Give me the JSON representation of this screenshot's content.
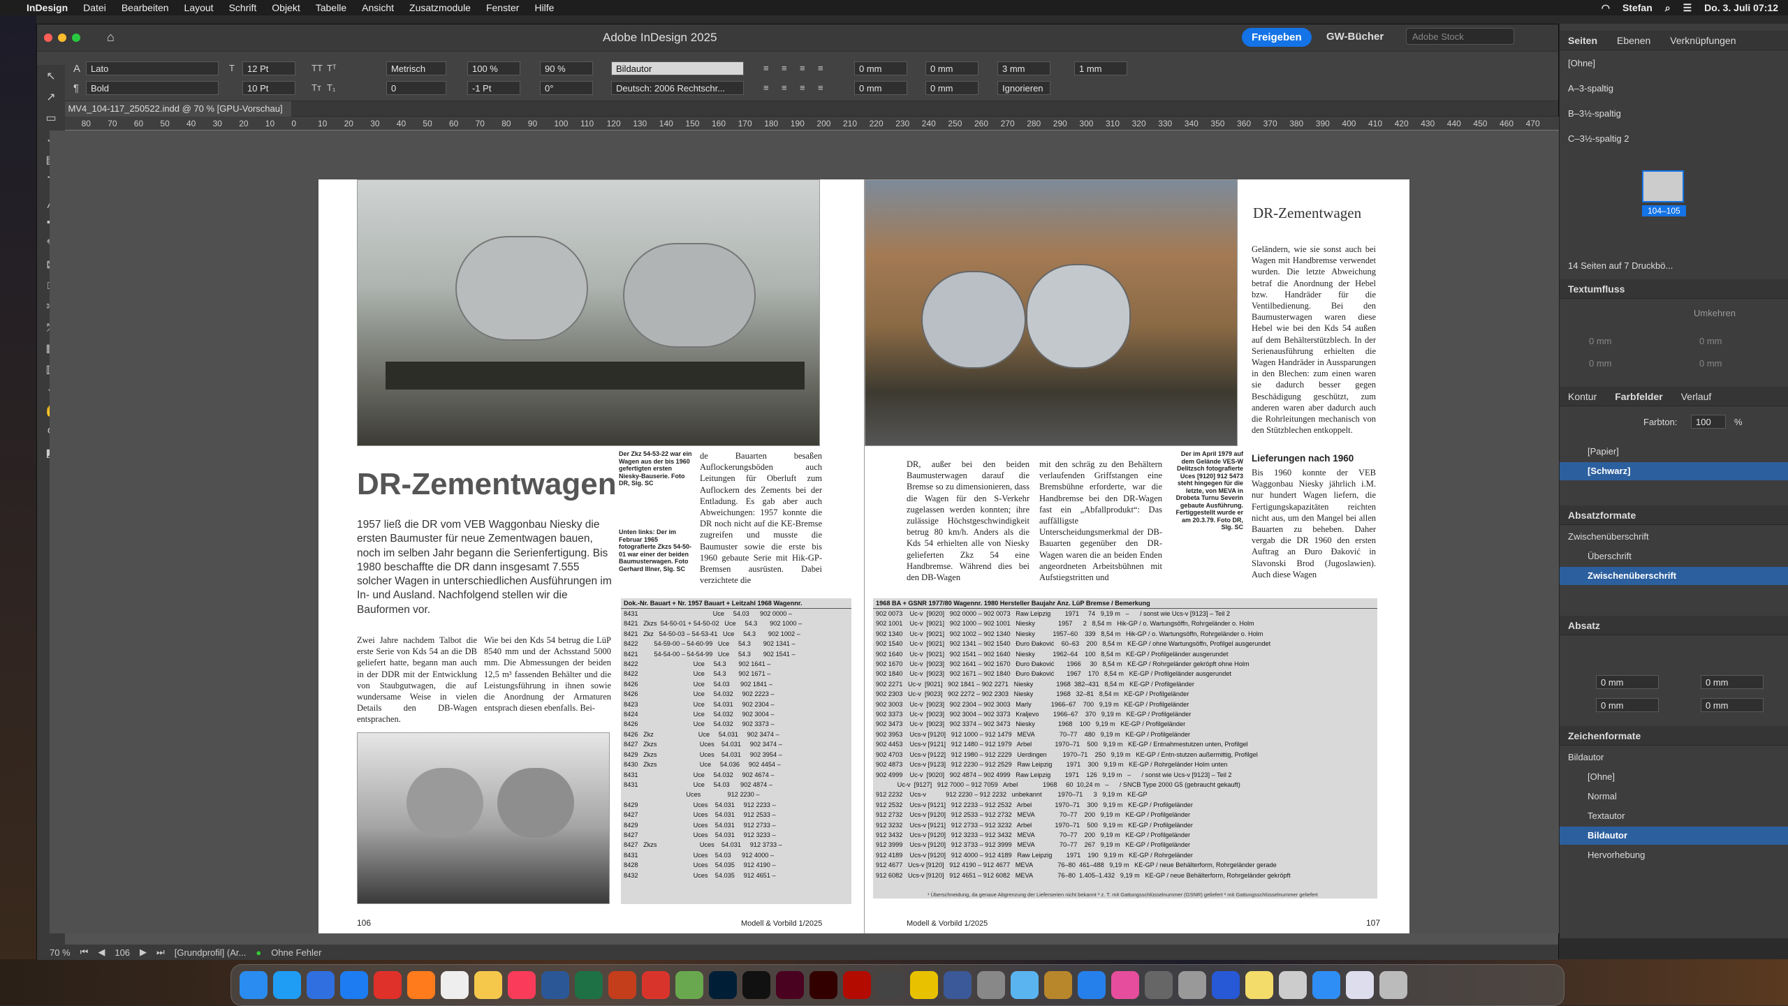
{
  "menubar": {
    "apple": "",
    "app": "InDesign",
    "items": [
      "Datei",
      "Bearbeiten",
      "Layout",
      "Schrift",
      "Objekt",
      "Tabelle",
      "Ansicht",
      "Zusatzmodule",
      "Fenster",
      "Hilfe"
    ],
    "user": "Stefan",
    "clock": "Do. 3. Juli 07:12"
  },
  "window": {
    "title": "Adobe InDesign 2025",
    "share": "Freigeben",
    "workspace": "GW-Bücher",
    "stock_placeholder": "Adobe Stock"
  },
  "control": {
    "font": "Lato",
    "style": "Bold",
    "size": "12 Pt",
    "leading": "10 Pt",
    "kerning": "Metrisch",
    "tracking": "0",
    "hscale": "100 %",
    "vscale": "90 %",
    "baseline": "-1 Pt",
    "skew": "0°",
    "charstyle": "Bildautor",
    "language": "Deutsch: 2006 Rechtschr...",
    "indent_l": "0 mm",
    "indent_r": "0 mm",
    "indent_fl": "0 mm",
    "indent_ll": "0 mm",
    "space_before": "3 mm",
    "space_after": "1 mm",
    "ignore": "Ignorieren"
  },
  "doc": {
    "tab": "MV4_104-117_250522.indd @ 70 % [GPU-Vorschau]"
  },
  "ruler": [
    "90",
    "80",
    "70",
    "60",
    "50",
    "40",
    "30",
    "20",
    "10",
    "0",
    "10",
    "20",
    "30",
    "40",
    "50",
    "60",
    "70",
    "80",
    "90",
    "100",
    "110",
    "120",
    "130",
    "140",
    "150",
    "160",
    "170",
    "180",
    "190",
    "200",
    "210",
    "220",
    "230",
    "240",
    "250",
    "260",
    "270",
    "280",
    "290",
    "300",
    "310",
    "320",
    "330",
    "340",
    "350",
    "360",
    "370",
    "380",
    "390",
    "400",
    "410",
    "420",
    "430",
    "440",
    "450",
    "460",
    "470"
  ],
  "page_left": {
    "headline": "DR-Zementwagen",
    "intro": "1957 ließ die DR vom VEB Waggonbau Niesky die ersten Baumuster für neue Zementwagen bauen, noch im selben Jahr begann die Serienfertigung. Bis 1980 beschaffte die DR dann insgesamt 7.555 solcher Wagen in unterschiedlichen Ausführungen im In- und Ausland. Nachfolgend stellen wir die Bauformen vor.",
    "cap_top": "Der Zkz 54-53-22 war ein Wagen aus der bis 1960 gefertigten ersten Niesky-Bauserie. Foto DR, Slg. SC",
    "cap_bottom": "Unten links: Der im Februar 1965 fotografierte Zkzs 54-50-01 war einer der beiden Baumusterwagen. Foto Gerhard Illner, Slg. SC",
    "col1": "Zwei Jahre nachdem Talbot die erste Serie von Kds 54 an die DB geliefert hatte, begann man auch in der DDR mit der Entwicklung von Staubgutwagen, die auf wundersame Weise in vielen Details den DB-Wagen entsprachen.",
    "col2": "Wie bei den Kds 54 betrug die LüP 8540 mm und der Achsstand 5000 mm. Die Abmessungen der beiden 12,5 m³ fassenden Behälter und die Leistungsführung in ihnen sowie die Anordnung der Armaturen entsprach diesen ebenfalls. Bei-",
    "col3": "de Bauarten besaßen Auflockerungsböden auch Leitungen für Oberluft zum Auflockern des Zements bei der Entladung. Es gab aber auch Abweichungen: 1957 konnte die DR noch nicht auf die KE-Bremse zugreifen und musste die Baumuster sowie die erste bis 1960 gebaute Serie mit Hik-GP-Bremsen ausrüsten. Dabei verzichtete die",
    "page_no": "106",
    "magazine": "Modell & Vorbild 1/2025"
  },
  "page_right": {
    "section_title": "DR-Zementwagen",
    "col_a": "Geländern, wie sie sonst auch bei Wagen mit Handbremse verwendet wurden. Die letzte Abweichung betraf die Anordnung der Hebel bzw. Handräder für die Ventilbedienung. Bei den Baumusterwagen waren diese Hebel wie bei den Kds 54 außen auf dem Behälterstützblech. In der Serienausführung erhielten die Wagen Handräder in Aussparungen in den Blechen: zum einen waren sie dadurch besser gegen Beschädigung geschützt, zum anderen waren aber dadurch auch die Rohrleitungen mechanisch von den Stützblechen entkoppelt.",
    "sub": "Lieferungen nach 1960",
    "col_b": "Bis 1960 konnte der VEB Waggonbau Niesky jährlich i.M. nur hundert Wagen liefern, die Fertigungskapazitäten reichten nicht aus, um den Mangel bei allen Bauarten zu beheben. Daher vergab die DR 1960 den ersten Auftrag an Đuro Đaković in Slavonski Brod (Jugoslawien). Auch diese Wagen",
    "col_c": "DR, außer bei den beiden Baumusterwagen darauf die Bremse so zu dimensionieren, dass die Wagen für den S-Verkehr zugelassen werden konnten; ihre zulässige Höchstgeschwindigkeit betrug 80 km/h. Anders als die Kds 54 erhielten alle von Niesky gelieferten Zkz 54 eine Handbremse. Während dies bei den DB-Wagen",
    "col_d": "mit den schräg zu den Behältern verlaufenden Griffstangen eine Bremsbühne erforderte, war die Handbremse bei den DR-Wagen fast ein „Abfallprodukt“: Das auffälligste Unterscheidungsmerkmal der DB-Bauarten gegenüber den DR-Wagen waren die an beiden Enden angeordneten Arbeitsbühnen mit Aufstiegstritten und",
    "cap": "Der im April 1979 auf dem Gelände VES-W Delitzsch fotografierte Uces [9120] 912 5473 steht hingegen für die letzte, von MEVA in Drobeta Turnu Severin gebaute Ausführung. Fertiggestellt wurde er am 20.3.79. Foto DR, Slg. SC",
    "page_no": "107",
    "magazine": "Modell & Vorbild 1/2025",
    "footnote": "¹ Überschneidung, da genaue Abgrenzung der Lieferserien nicht bekannt   ² z. T. mit Gattungsschlüsselnummer (GSNR) geliefert   ³ mit Gattungsschlüsselnummer geliefert"
  },
  "table_left": {
    "headers": "Dok.-Nr.     Bauart + Nr. 1957      Bauart + Leitzahl 1968     Wagennr.",
    "rows": [
      "8431                                          Uce     54.03      902 0000 –",
      "8421   Zkzs  54-50-01 + 54-50-02   Uce     54.3       902 1000 –",
      "8421   Zkz   54-50-03 – 54-53-41   Uce     54.3       902 1002 –",
      "8422         54-59-00 – 54-60-99   Uce     54.3       902 1341 –",
      "8421         54-54-00 – 54-54-99   Uce     54.3       902 1541 –",
      "8422                               Uce     54.3       902 1641 –",
      "8422                               Uce     54.3       902 1671 –",
      "8426                               Uce     54.03      902 1841 –",
      "8426                               Uce     54.032     902 2223 –",
      "8423                               Uce     54.031     902 2304 –",
      "8424                               Uce     54.032     902 3004 –",
      "8426                               Uce     54.032     902 3373 –",
      "8426   Zkz                         Uce     54.031     902 3474 –",
      "8427   Zkzs                        Uces    54.031     902 3474 –",
      "8429   Zkzs                        Uces    54.031     902 3954 –",
      "8430   Zkzs                        Uce     54.036     902 4454 –",
      "8431                               Uce     54.032     902 4674 –",
      "8431                               Uce     54.03      902 4874 –",
      "",
      "                                   Uces               912 2230 –",
      "8429                               Uces    54.031     912 2233 –",
      "8427                               Uces    54.031     912 2533 –",
      "8429                               Uces    54.031     912 2733 –",
      "8427                               Uces    54.031     912 3233 –",
      "8427   Zkzs                        Uces    54.031     912 3733 –",
      "8431                               Uces    54.03      912 4000 –",
      "8428                               Uces    54.035     912 4190 –",
      "8432                               Uces    54.035     912 4651 –"
    ]
  },
  "table_right": {
    "headers": "1968      BA + GSNR 1977/80   Wagennr. 1980         Hersteller       Baujahr      Anz.    LüP   Bremse / Bemerkung",
    "rows": [
      "902 0073    Uc-v  [9020]   902 0000 – 902 0073   Raw Leipzig        1971     74   9,19 m   –      / sonst wie Ucs-v [9123] – Teil 2",
      "902 1001    Uc-v  [9021]   902 1000 – 902 1001   Niesky             1957      2   8,54 m   Hik-GP / o. Wartungsöffn, Rohrgeländer o. Holm",
      "902 1340    Uc-v  [9021]   902 1002 – 902 1340   Niesky          1957–60    339   8,54 m   Hik-GP / o. Wartungsöffn, Rohrgeländer o. Holm",
      "902 1540    Uc-v  [9021]   902 1341 – 902 1540   Đuro Đaković    60–63    200   8,54 m   KE-GP / ohne Wartungsöffn, Profilgel ausgerundet",
      "902 1640    Uc-v  [9021]   902 1541 – 902 1640   Niesky          1962–64    100   8,54 m   KE-GP / Profilgeländer ausgerundet",
      "902 1670    Uc-v  [9023]   902 1641 – 902 1670   Đuro Đaković       1966     30   8,54 m   KE-GP / Rohrgeländer gekröpft ohne Holm",
      "902 1840    Uc-v  [9023]   902 1671 – 902 1840   Đuro Đaković       1967    170   8,54 m   KE-GP / Profilgeländer ausgerundet",
      "902 2271   Uc-v  [9021]   902 1841 – 902 2271   Niesky             1968  382–431   8,54 m   KE-GP / Profilgeländer",
      "902 2303   Uc-v  [9023]   902 2272 – 902 2303   Niesky             1968   32–81   8,54 m   KE-GP / Profilgeländer",
      "902 3003    Uc-v  [9023]   902 2304 – 902 3003   Marly           1966–67    700   9,19 m   KE-GP / Profilgeländer",
      "902 3373    Uc-v  [9023]   902 3004 – 902 3373   Kraljevo        1966–67    370   9,19 m   KE-GP / Profilgeländer",
      "902 3473    Uc-v  [9023]   902 3374 – 902 3473   Niesky             1968    100   9,19 m   KE-GP / Profilgeländer",
      "902 3953    Ucs-v [9120]   912 1000 – 912 1479   MEVA              70–77    480   9,19 m   KE-GP / Profilgeländer",
      "902 4453    Ucs-v [9121]   912 1480 – 912 1979   Arbel             1970–71    500   9,19 m   KE-GP / Entnahmestutzen unten, Profilgel",
      "902 4703    Ucs-v [9122]   912 1980 – 912 2229   Uerdingen         1970–71    250   9,19 m   KE-GP / Entn-stutzen außermittig, Profilgel",
      "902 4873    Ucs-v [9123]   912 2230 – 912 2529   Raw Leipzig        1971    300   9,19 m   KE-GP / Rohrgeländer Holm unten",
      "902 4999    Uc-v  [9020]   902 4874 – 902 4999   Raw Leipzig        1971    126   9,19 m   –      / sonst wie Ucs-v [9123] – Teil 2",
      "            Uc-v  [9127]   912 7000 – 912 7059   Arbel              1968     60  10,24 m   –      / SNCB Type 2000 G5 (gebraucht gekauft)",
      "912 2232    Ucs-v           912 2230 – 912 2232   unbekannt         1970–71      3   9,19 m   KE-GP",
      "912 2532    Ucs-v [9121]   912 2233 – 912 2532   Arbel             1970–71    300   9,19 m   KE-GP / Profilgeländer",
      "912 2732    Ucs-v [9120]   912 2533 – 912 2732   MEVA              70–77    200   9,19 m   KE-GP / Profilgeländer",
      "912 3232    Ucs-v [9121]   912 2733 – 912 3232   Arbel             1970–71    500   9,19 m   KE-GP / Profilgeländer",
      "912 3432    Ucs-v [9120]   912 3233 – 912 3432   MEVA              70–77    200   9,19 m   KE-GP / Profilgeländer",
      "912 3999    Ucs-v [9120]   912 3733 – 912 3999   MEVA              70–77    267   9,19 m   KE-GP / Profilgeländer",
      "912 4189    Ucs-v [9120]   912 4000 – 912 4189   Raw Leipzig        1971    190   9,19 m   KE-GP / Rohrgeländer",
      "912 4677   Ucs-v [9120]   912 4190 – 912 4677   MEVA              76–80  461–488   9,19 m   KE-GP / neue Behälterform, Rohrgeländer gerade",
      "912 6082   Ucs-v [9120]   912 4651 – 912 6082   MEVA              76–80  1.405–1.432   9,19 m   KE-GP / neue Behälterform, Rohrgeländer gekröpft"
    ]
  },
  "status": {
    "zoom": "70 %",
    "page": "106",
    "profile": "[Grundprofil] (Ar...",
    "errors": "Ohne Fehler"
  },
  "panels": {
    "tabs": [
      "Seiten",
      "Ebenen",
      "Verknüpfungen"
    ],
    "master": [
      "[Ohne]",
      "A–3-spaltig",
      "B–3½-spaltig",
      "C–3½-spaltig 2"
    ],
    "spread_label": "104–105",
    "pages_info": "14 Seiten auf 7 Druckbö...",
    "textflow": "Textumfluss",
    "wrap_label": "Umkehren",
    "wrap_vals": [
      "0 mm",
      "0 mm",
      "0 mm",
      "0 mm"
    ],
    "color_tabs": [
      "Kontur",
      "Farbfelder",
      "Verlauf"
    ],
    "tint_label": "Farbton:",
    "tint": "100",
    "tint_unit": "%",
    "swatches": [
      "[Papier]",
      "[Schwarz]"
    ],
    "parastyles_head": "Absatzformate",
    "parastyles": [
      "Zwischenüberschrift",
      "Überschrift",
      "Zwischenüberschrift"
    ],
    "para_head": "Absatz",
    "para_vals": [
      "0 mm",
      "0 mm",
      "0 mm",
      "0 mm"
    ],
    "charstyles_head": "Zeichenformate",
    "charstyle_current": "Bildautor",
    "charstyles": [
      "[Ohne]",
      "Normal",
      "Textautor",
      "Bildautor",
      "Hervorhebung"
    ]
  }
}
